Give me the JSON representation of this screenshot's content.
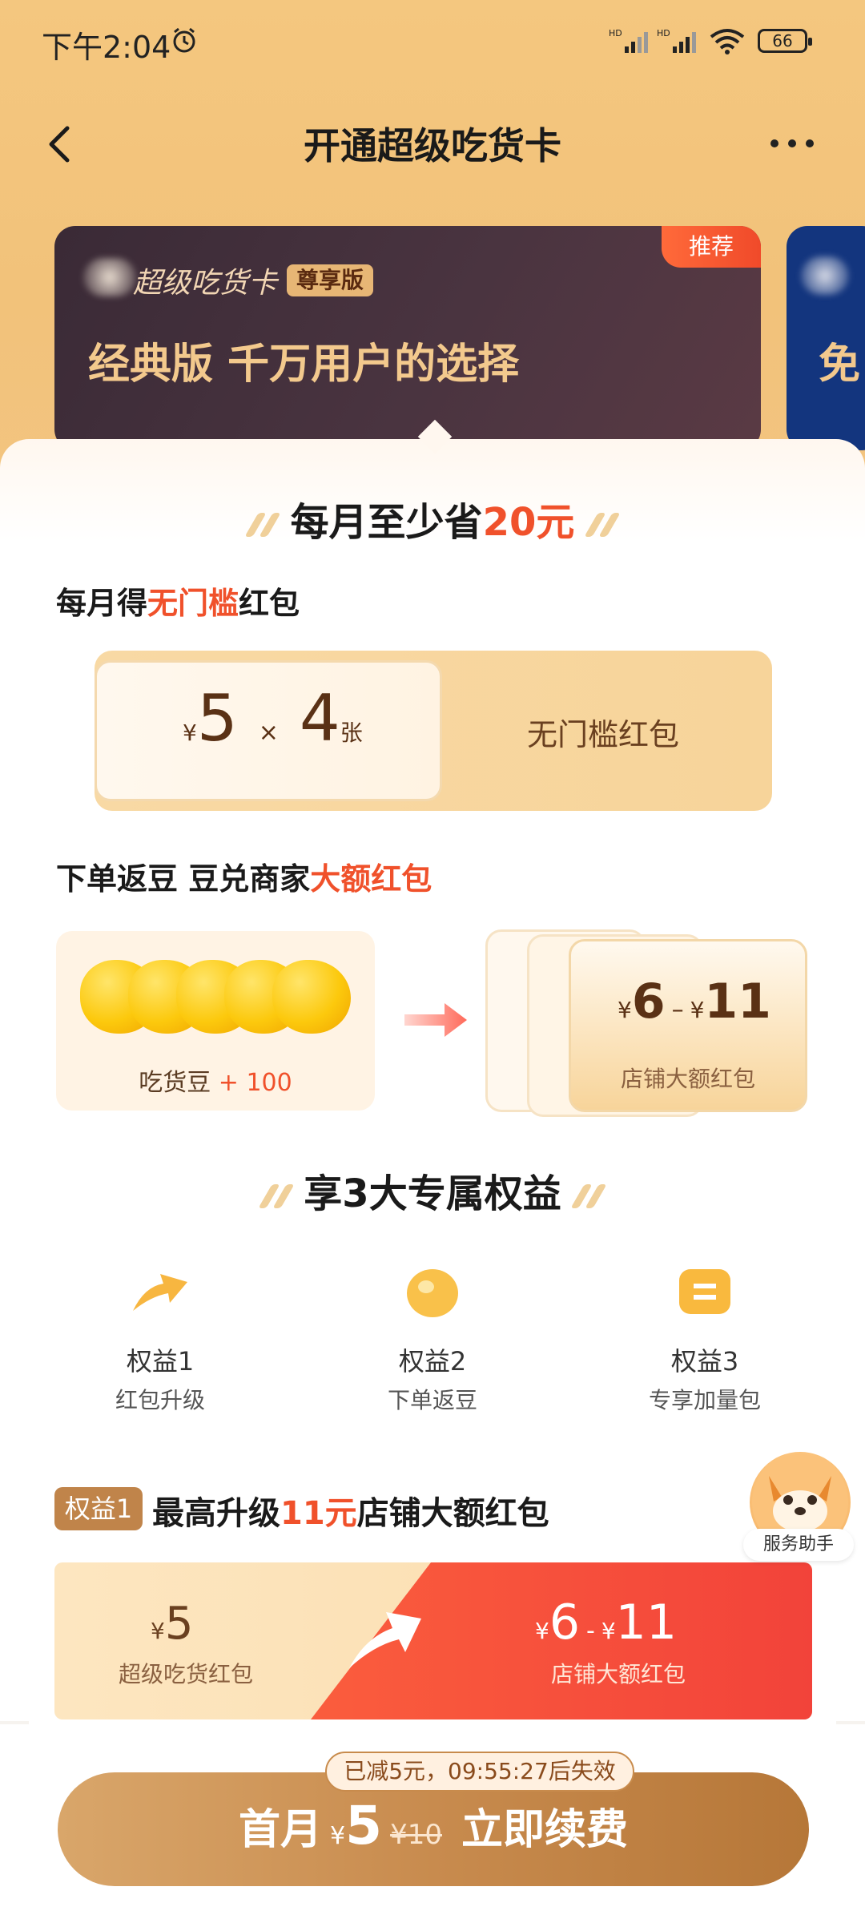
{
  "status_bar": {
    "time": "下午2:04",
    "battery": "66"
  },
  "nav": {
    "title": "开通超级吃货卡"
  },
  "card": {
    "brand": "超级吃货卡",
    "tier": "尊享版",
    "headline": "经典版 千万用户的选择",
    "recommend": "推荐",
    "next_card_text": "免"
  },
  "section1": {
    "title_prefix": "每月至少省",
    "title_highlight": "20元"
  },
  "coupon_section": {
    "label_prefix": "每月得",
    "label_highlight": "无门槛",
    "label_suffix": "红包",
    "currency": "¥",
    "amount": "5",
    "times": "×",
    "count": "4",
    "unit": "张",
    "name": "无门槛红包"
  },
  "bean_section": {
    "label_prefix": "下单返豆  豆兑商家",
    "label_highlight": "大额红包",
    "bean_label": "吃货豆",
    "bean_plus": "+ 100",
    "range_currency": "¥",
    "range_low": "6",
    "range_dash": "–",
    "range_high": "11",
    "range_caption": "店铺大额红包"
  },
  "section2": {
    "title": "享3大专属权益"
  },
  "benefits": [
    {
      "title": "权益1",
      "desc": "红包升级",
      "icon": "upgrade-arrow-icon"
    },
    {
      "title": "权益2",
      "desc": "下单返豆",
      "icon": "bean-icon"
    },
    {
      "title": "权益3",
      "desc": "专享加量包",
      "icon": "bonus-pack-icon"
    }
  ],
  "benefit1_detail": {
    "tag": "权益1",
    "head_prefix": "最高升级",
    "head_highlight": "11元",
    "head_suffix": "店铺大额红包",
    "from_currency": "¥",
    "from_amount": "5",
    "from_caption": "超级吃货红包",
    "to_currency": "¥",
    "to_low": "6",
    "to_dash": "-",
    "to_high": "11",
    "to_caption": "店铺大额红包"
  },
  "assistant": {
    "label": "服务助手"
  },
  "bottom": {
    "tip": "已减5元，09:55:27后失效",
    "first_month": "首月",
    "currency": "¥",
    "price": "5",
    "original": "¥10",
    "action": "立即续费"
  },
  "colors": {
    "accent": "#f0512b",
    "gold": "#c88b4e",
    "header_bg": "#f4c77f"
  }
}
